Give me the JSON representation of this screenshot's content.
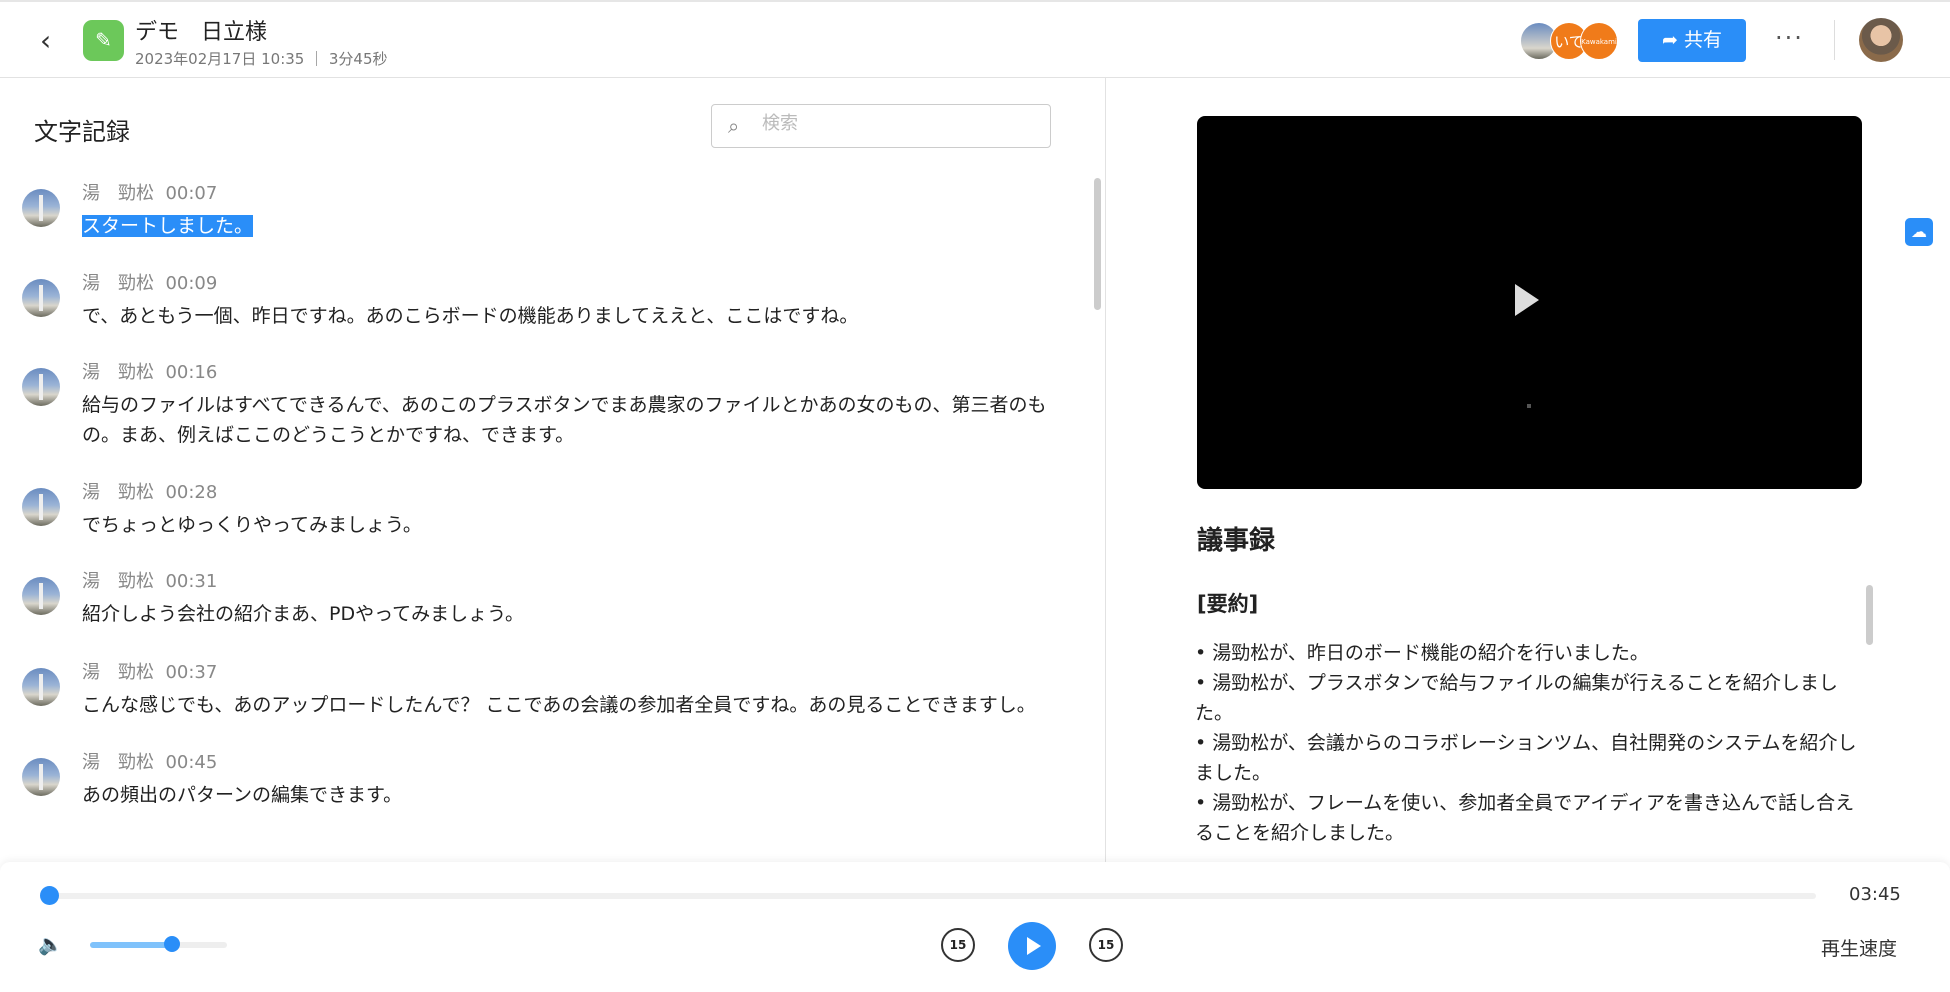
{
  "header": {
    "title": "デモ　日立様",
    "subtitle": "2023年02月17日 10:35 ｜ 3分45秒",
    "participants": [
      "いて",
      "Kawakami"
    ],
    "share_label": "共有",
    "more_label": "···"
  },
  "transcript": {
    "title": "文字記録",
    "search_placeholder": "検索",
    "entries": [
      {
        "speaker": "湯　勁松",
        "time": "00:07",
        "text": "スタートしました。"
      },
      {
        "speaker": "湯　勁松",
        "time": "00:09",
        "text": "で、あともう一個、昨日ですね。あのこらボードの機能ありましてええと、ここはですね。"
      },
      {
        "speaker": "湯　勁松",
        "time": "00:16",
        "text": "給与のファイルはすべてできるんで、あのこのプラスボタンでまあ農家のファイルとかあの女のもの、第三者のもの。まあ、例えばここのどうこうとかですね、できます。"
      },
      {
        "speaker": "湯　勁松",
        "time": "00:28",
        "text": "でちょっとゆっくりやってみましょう。"
      },
      {
        "speaker": "湯　勁松",
        "time": "00:31",
        "text": "紹介しよう会社の紹介まあ、PDやってみましょう。"
      },
      {
        "speaker": "湯　勁松",
        "time": "00:37",
        "text": "こんな感じでも、あのアップロードしたんで？ ここであの会議の参加者全員ですね。あの見ることできますし。"
      },
      {
        "speaker": "湯　勁松",
        "time": "00:45",
        "text": "あの頻出のパターンの編集できます。"
      }
    ]
  },
  "minutes": {
    "title": "議事録",
    "section": "[要約]",
    "bullets": [
      "• 湯勁松が、昨日のボード機能の紹介を行いました。",
      "• 湯勁松が、プラスボタンで給与ファイルの編集が行えることを紹介しました。",
      "• 湯勁松が、会議からのコラボレーションツム、自社開発のシステムを紹介しました。",
      "• 湯勁松が、フレームを使い、参加者全員でアイディアを書き込んで話し合えることを紹介しました。"
    ]
  },
  "player": {
    "duration": "03:45",
    "progress": 0,
    "volume": 0.6,
    "skip_back": "15",
    "skip_forward": "15",
    "speed_label": "再生速度"
  }
}
